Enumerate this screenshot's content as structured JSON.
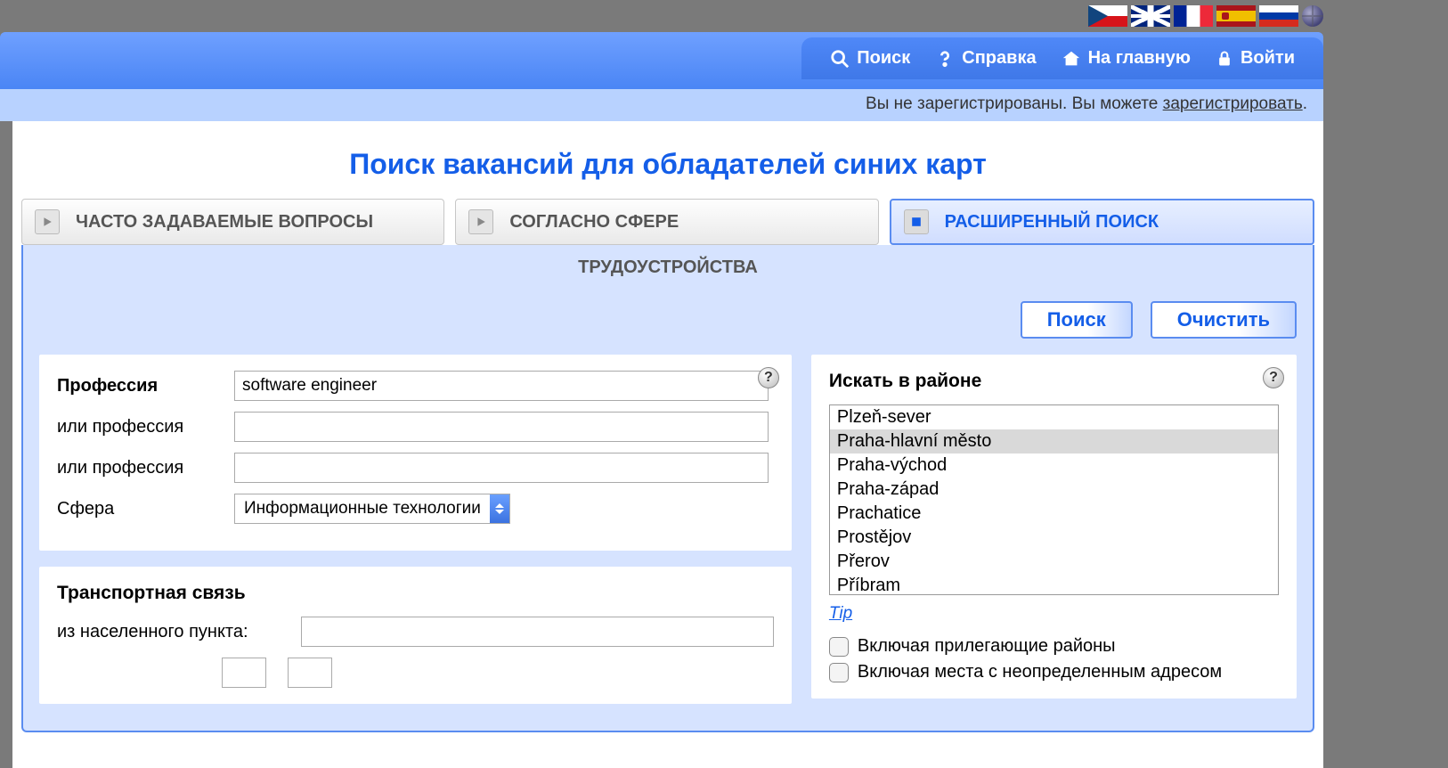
{
  "nav": {
    "search": "Поиск",
    "help": "Справка",
    "home": "На главную",
    "login": "Войти"
  },
  "noreg": {
    "prefix": "Вы не зарегистрированы. Вы можете ",
    "link": "зарегистрировать",
    "suffix": "."
  },
  "page_title": "Поиск вакансий для обладателей синих карт",
  "tabs": {
    "faq": "ЧАСТО ЗАДАВАЕМЫЕ ВОПРОСЫ",
    "by_area": "СОГЛАСНО СФЕРЕ",
    "sub_label": "ТРУДОУСТРОЙСТВА",
    "advanced": "РАСШИРЕННЫЙ ПОИСК"
  },
  "actions": {
    "search": "Поиск",
    "clear": "Очистить"
  },
  "form": {
    "profession_label": "Профессия",
    "profession_value": "software engineer",
    "or_profession": "или профессия",
    "sphere_label": "Сфера",
    "sphere_value": "Информационные технологии"
  },
  "transport": {
    "title": "Транспортная связь",
    "from_label": "из населенного пункта:"
  },
  "region": {
    "title": "Искать в районе",
    "items": [
      "Plzeň-sever",
      "Praha-hlavní město",
      "Praha-východ",
      "Praha-západ",
      "Prachatice",
      "Prostějov",
      "Přerov",
      "Příbram"
    ],
    "selected_index": 1,
    "tip": "Tip",
    "include_adjacent": "Включая прилегающие районы",
    "include_undefined": "Включая места с неопределенным адресом"
  }
}
